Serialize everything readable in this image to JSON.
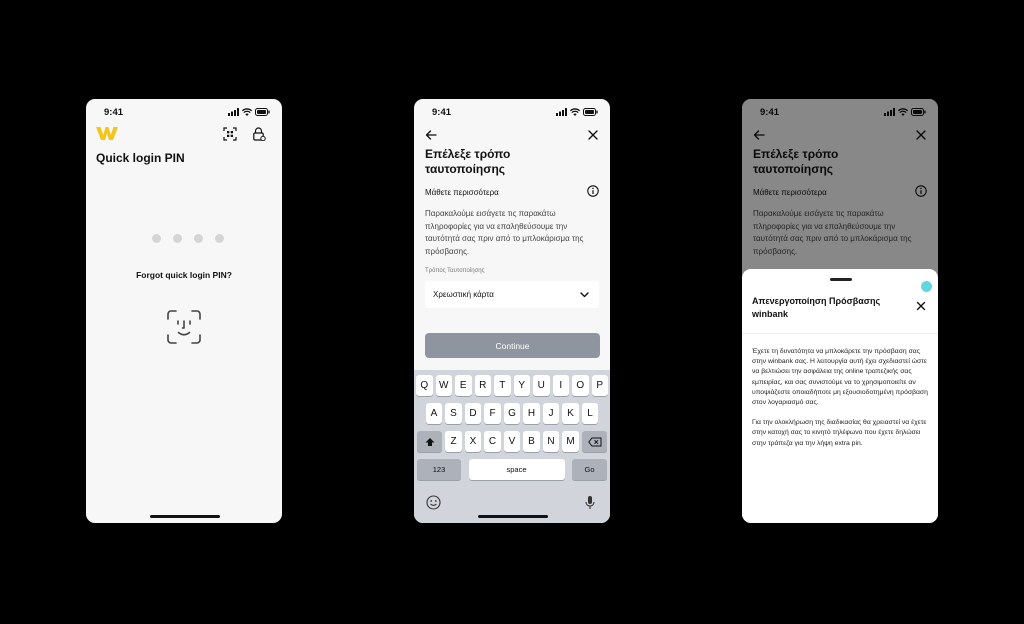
{
  "status_bar": {
    "time": "9:41"
  },
  "screen1": {
    "title": "Quick login PIN",
    "forgot_link": "Forgot quick login PIN?",
    "brand_color": "#f5c518",
    "icons": [
      "logo-icon",
      "qr-scan-icon",
      "lock-icon",
      "face-id-icon"
    ]
  },
  "screen2": {
    "title": "Επέλεξε τρόπο ταυτοποίησης",
    "learn_more": "Μάθετε περισσότερα",
    "description": "Παρακαλούμε εισάγετε τις παρακάτω πληροφορίες για να επαληθεύσουμε την ταυτότητά σας πριν από το μπλοκάρισμα της πρόσβασης.",
    "field_label": "Τρόπος Ταυτοποίησης",
    "select_value": "Χρεωστική κάρτα",
    "continue_label": "Continue",
    "keyboard": {
      "row1": [
        "Q",
        "W",
        "E",
        "R",
        "T",
        "Y",
        "U",
        "I",
        "O",
        "P"
      ],
      "row2": [
        "A",
        "S",
        "D",
        "F",
        "G",
        "H",
        "J",
        "K",
        "L"
      ],
      "row3": [
        "Z",
        "X",
        "C",
        "V",
        "B",
        "N",
        "M"
      ],
      "numbers_key": "123",
      "space_key": "space",
      "go_key": "Go"
    }
  },
  "screen3": {
    "background_title": "Επέλεξε τρόπο ταυτοποίησης",
    "background_learn_more": "Μάθετε περισσότερα",
    "background_description": "Παρακαλούμε εισάγετε τις παρακάτω πληροφορίες για να επαληθεύσουμε την ταυτότητά σας πριν από το μπλοκάρισμα της πρόσβασης.",
    "sheet_title": "Απενεργοποίηση Πρόσβασης winbank",
    "sheet_paragraph1": "Έχετε τη δυνατότητα να μπλοκάρετε την πρόσβαση σας στην winbank σας. Η λειτουργία αυτή έχει σχεδιαστεί ώστε να βελτιώσει την ασφάλεια της online τραπεζικής σας εμπειρίας, και σας συνιστούμε να το χρησιμοποιείτε αν υποψιάζεστε οποιαδήποτε μη εξουσιοδοτημένη πρόσβαση στον λογαριασμό σας.",
    "sheet_paragraph2": "Για την ολοκλήρωση της διαδικασίας θα χρειαστεί να έχετε στην κατοχή σας το κινητό τηλέφωνο που έχετε δηλώσει στην τράπεζα για την λήψη extra pin.",
    "accent_color": "#5fd6e0"
  }
}
